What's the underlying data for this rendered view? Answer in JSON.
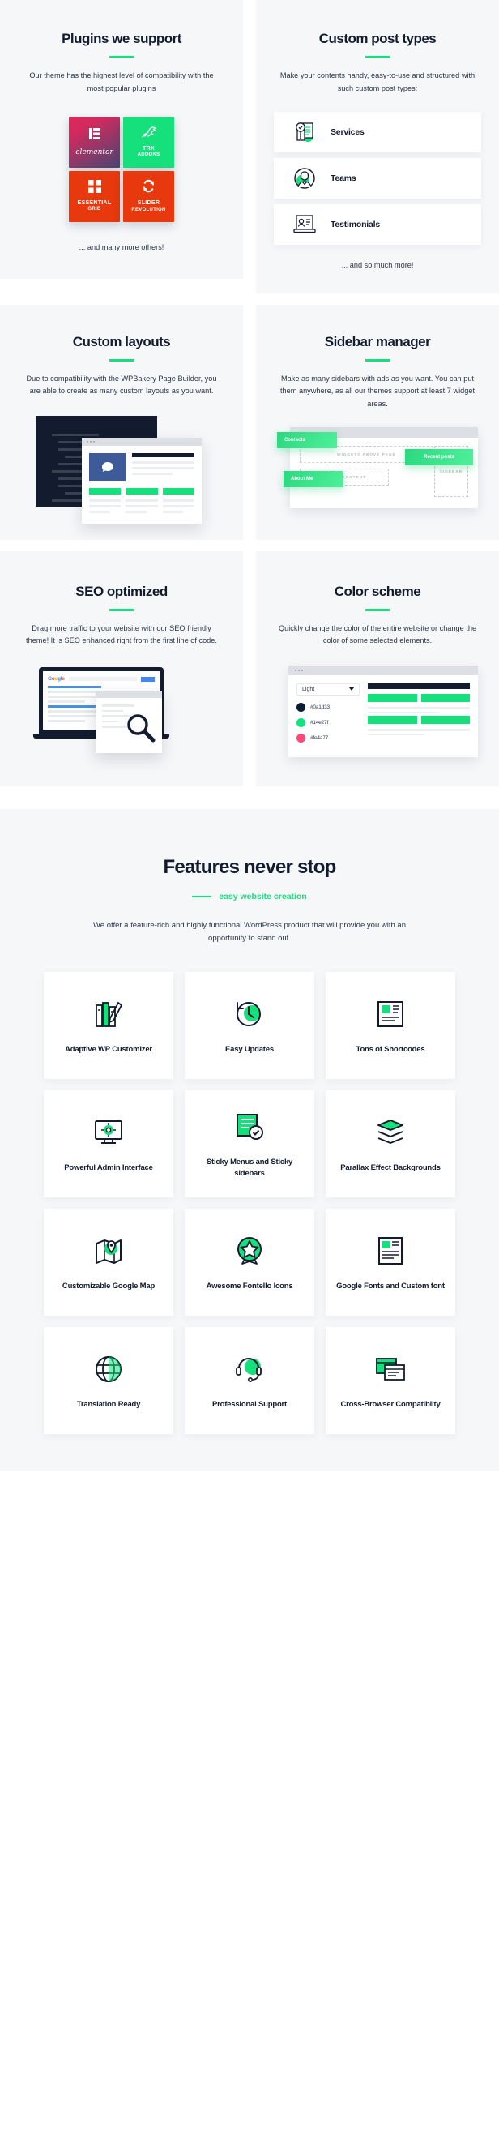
{
  "sections": {
    "plugins": {
      "title": "Plugins we support",
      "desc": "Our theme has the highest level of compatibility with the most popular plugins",
      "note": "... and many more others!",
      "tiles": [
        {
          "name": "elementor",
          "icon": "elementor-icon",
          "color": "#d12a5f"
        },
        {
          "name": "TRX",
          "sub": "ADDONS",
          "icon": "trx-kangaroo-icon",
          "color": "#15e07c"
        },
        {
          "name": "ESSENTIAL",
          "sub": "GRID",
          "icon": "grid-squares-icon",
          "color": "#e8380d"
        },
        {
          "name": "SLIDER",
          "sub": "REVOLUTION",
          "icon": "refresh-arrows-icon",
          "color": "#e8380d"
        }
      ]
    },
    "post_types": {
      "title": "Custom post types",
      "desc": "Make your contents handy, easy-to-use and structured with such custom post types:",
      "note": "... and so much more!",
      "items": [
        {
          "label": "Services",
          "icon": "document-checklist-icon"
        },
        {
          "label": "Teams",
          "icon": "person-avatar-icon"
        },
        {
          "label": "Testimonials",
          "icon": "laptop-quote-icon"
        }
      ]
    },
    "layouts": {
      "title": "Custom layouts",
      "desc": "Due to compatibility with the WPBakery Page Builder, you are able to create as many custom layouts as you want."
    },
    "sidebar": {
      "title": "Sidebar manager",
      "desc": "Make as many sidebars with ads as you want. You can put them anywhere, as all our themes support at least 7 widget areas.",
      "slots": [
        "WIDGETS ABOVE PAGE",
        "ABOVE CONTENT",
        "SIDEBAR"
      ],
      "chips": [
        "Contacts",
        "Recent posts",
        "About Me"
      ]
    },
    "seo": {
      "title": "SEO optimized",
      "desc": "Drag more traffic to your website with our SEO friendly theme! It is SEO enhanced right from the first line of code.",
      "google_logo": "Google"
    },
    "color_scheme": {
      "title": "Color scheme",
      "desc": "Quickly change the color of the entire website or change the color of some selected elements.",
      "select_value": "Light",
      "swatches": [
        {
          "hex": "#0a1d33",
          "label": "#0a1d33"
        },
        {
          "hex": "#14e27f",
          "label": "#14e27f"
        },
        {
          "hex": "#fe4a77",
          "label": "#fe4a77"
        }
      ]
    }
  },
  "features": {
    "title": "Features never stop",
    "subtitle": "easy website creation",
    "lead": "We offer a feature-rich and highly functional WordPress product that will provide you with an opportunity to stand out.",
    "cards": [
      {
        "label": "Adaptive WP Customizer",
        "icon": "books-pencil-icon"
      },
      {
        "label": "Easy Updates",
        "icon": "refresh-circle-icon"
      },
      {
        "label": "Tons of Shortcodes",
        "icon": "layout-blocks-icon"
      },
      {
        "label": "Powerful Admin Interface",
        "icon": "monitor-gear-icon"
      },
      {
        "label": "Sticky Menus and Sticky sidebars",
        "icon": "sticky-checklist-icon"
      },
      {
        "label": "Parallax Effect Backgrounds",
        "icon": "layers-stack-icon"
      },
      {
        "label": "Customizable Google Map",
        "icon": "map-pin-icon"
      },
      {
        "label": "Awesome Fontello Icons",
        "icon": "star-badge-icon"
      },
      {
        "label": "Google Fonts and Custom font",
        "icon": "typography-page-icon"
      },
      {
        "label": "Translation Ready",
        "icon": "globe-icon"
      },
      {
        "label": "Professional Support",
        "icon": "support-headset-icon"
      },
      {
        "label": "Cross-Browser Compatiblity",
        "icon": "browser-windows-icon"
      }
    ]
  },
  "colors": {
    "accent": "#15e07c",
    "dark": "#131c2e",
    "panel": "#f5f7f9",
    "text": "#2b3646"
  }
}
